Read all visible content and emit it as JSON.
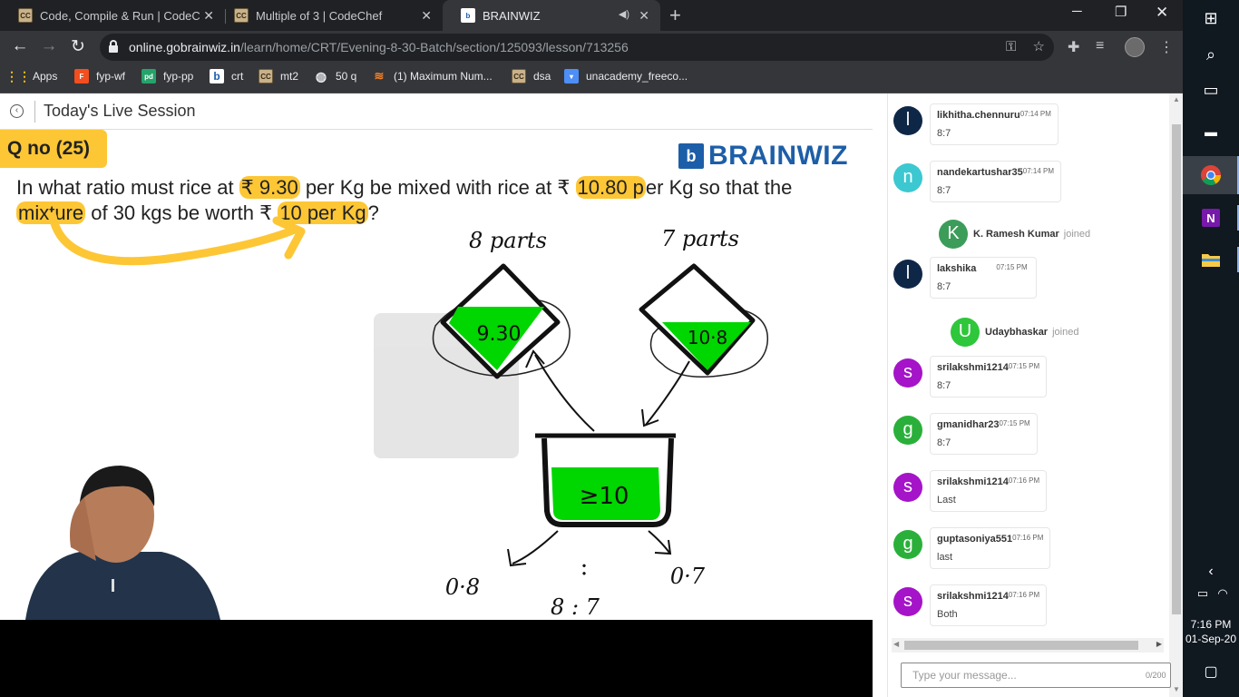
{
  "browser": {
    "tabs": [
      {
        "title": "Code, Compile & Run | CodeChef",
        "favicon": "codechef-icon"
      },
      {
        "title": "Multiple of 3 | CodeChef",
        "favicon": "codechef-icon"
      },
      {
        "title": "BRAINWIZ",
        "favicon": "brainwiz-icon",
        "active": true
      }
    ],
    "url_host": "online.gobrainwiz.in",
    "url_path": "/learn/home/CRT/Evening-8-30-Batch/section/125093/lesson/713256",
    "bookmarks": [
      "Apps",
      "fyp-wf",
      "fyp-pp",
      "crt",
      "mt2",
      "50 q",
      "(1) Maximum Num...",
      "dsa",
      "unacademy_freeco..."
    ]
  },
  "session": {
    "title": "Today's Live Session"
  },
  "slide": {
    "qno": "Q no (25)",
    "logo_text": "BRAINWIZ",
    "logo_letter": "b",
    "watermark": "BRAINWIZ",
    "question": {
      "p1": "In what ratio must rice at ",
      "h1": "₹ 9.30",
      "p2": " per Kg be mixed with rice at ₹ ",
      "h2": "10.80 p",
      "p3": "er Kg so that the ",
      "h3": "mixture",
      "p4": " of 30 kgs be worth ₹ ",
      "h4": "10 per Kg",
      "p5": "?"
    },
    "annotations": {
      "left_parts": "8 parts",
      "right_parts": "7 parts",
      "left_price": "9.30",
      "right_price": "10·8",
      "mix": "≥10",
      "left_diff": "0·8",
      "right_diff": "0·7",
      "colon": ":",
      "ratio": "8 : 7"
    },
    "colors": {
      "highlight": "#fdc635",
      "brand": "#1d5ea8",
      "liquid": "#00d600"
    }
  },
  "chat": {
    "messages": [
      {
        "type": "msg",
        "avatar": "l",
        "color": "#0f2747",
        "user": "likhitha.chennuru",
        "time": "07:14 PM",
        "text": "8:7"
      },
      {
        "type": "msg",
        "avatar": "n",
        "color": "#3cc8d0",
        "user": "nandekartushar35",
        "time": "07:14 PM",
        "text": "8:7"
      },
      {
        "type": "join",
        "avatar": "K",
        "color": "#3c9c5a",
        "user": "K. Ramesh Kumar",
        "label": "joined"
      },
      {
        "type": "msg",
        "avatar": "l",
        "color": "#0f2747",
        "user": "lakshika",
        "time": "07:15 PM",
        "text": "8:7"
      },
      {
        "type": "join",
        "avatar": "U",
        "color": "#2ec63a",
        "user": "Udaybhaskar",
        "label": "joined"
      },
      {
        "type": "msg",
        "avatar": "s",
        "color": "#a514c8",
        "user": "srilakshmi1214",
        "time": "07:15 PM",
        "text": "8:7"
      },
      {
        "type": "msg",
        "avatar": "g",
        "color": "#2ab03a",
        "user": "gmanidhar23",
        "time": "07:15 PM",
        "text": "8:7"
      },
      {
        "type": "msg",
        "avatar": "s",
        "color": "#a514c8",
        "user": "srilakshmi1214",
        "time": "07:16 PM",
        "text": "Last"
      },
      {
        "type": "msg",
        "avatar": "g",
        "color": "#2ab03a",
        "user": "guptasoniya551",
        "time": "07:16 PM",
        "text": "last"
      },
      {
        "type": "msg",
        "avatar": "s",
        "color": "#a514c8",
        "user": "srilakshmi1214",
        "time": "07:16 PM",
        "text": "Both"
      }
    ],
    "input_placeholder": "Type your message...",
    "char_count": "0/200"
  },
  "taskbar": {
    "time": "7:16 PM",
    "date": "01-Sep-20"
  }
}
